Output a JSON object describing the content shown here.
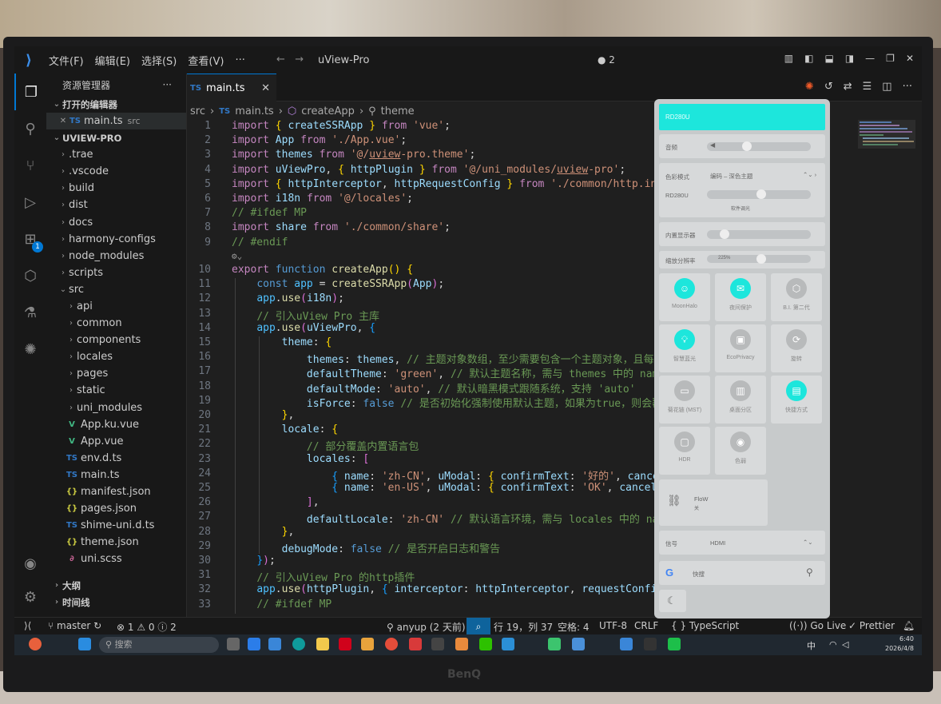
{
  "titlebar": {
    "menus": [
      "文件(F)",
      "编辑(E)",
      "选择(S)",
      "查看(V)",
      "···"
    ],
    "title": "uView-Pro",
    "badge": "● 2"
  },
  "sidebar": {
    "header": "资源管理器",
    "open_editors": "打开的编辑器",
    "open_file": "main.ts",
    "open_file_dir": "src",
    "project": "UVIEW-PRO",
    "items": [
      {
        "label": ".trae",
        "type": "folder",
        "depth": 1
      },
      {
        "label": ".vscode",
        "type": "folder",
        "depth": 1
      },
      {
        "label": "build",
        "type": "folder",
        "depth": 1
      },
      {
        "label": "dist",
        "type": "folder",
        "depth": 1
      },
      {
        "label": "docs",
        "type": "folder",
        "depth": 1
      },
      {
        "label": "harmony-configs",
        "type": "folder",
        "depth": 1
      },
      {
        "label": "node_modules",
        "type": "folder",
        "depth": 1
      },
      {
        "label": "scripts",
        "type": "folder",
        "depth": 1
      },
      {
        "label": "src",
        "type": "folder-open",
        "depth": 1
      },
      {
        "label": "api",
        "type": "folder",
        "depth": 2
      },
      {
        "label": "common",
        "type": "folder",
        "depth": 2
      },
      {
        "label": "components",
        "type": "folder",
        "depth": 2
      },
      {
        "label": "locales",
        "type": "folder",
        "depth": 2
      },
      {
        "label": "pages",
        "type": "folder",
        "depth": 2
      },
      {
        "label": "static",
        "type": "folder",
        "depth": 2
      },
      {
        "label": "uni_modules",
        "type": "folder",
        "depth": 2
      },
      {
        "label": "App.ku.vue",
        "type": "vue",
        "depth": 2
      },
      {
        "label": "App.vue",
        "type": "vue",
        "depth": 2
      },
      {
        "label": "env.d.ts",
        "type": "ts",
        "depth": 2
      },
      {
        "label": "main.ts",
        "type": "ts",
        "depth": 2
      },
      {
        "label": "manifest.json",
        "type": "json",
        "depth": 2
      },
      {
        "label": "pages.json",
        "type": "json",
        "depth": 2
      },
      {
        "label": "shime-uni.d.ts",
        "type": "ts",
        "depth": 2
      },
      {
        "label": "theme.json",
        "type": "json",
        "depth": 2
      },
      {
        "label": "uni.scss",
        "type": "scss",
        "depth": 2
      }
    ],
    "outline": "大纲",
    "timeline": "时间线"
  },
  "tab": {
    "label": "main.ts",
    "close": "✕"
  },
  "breadcrumb": [
    "src",
    "main.ts",
    "createApp",
    "theme"
  ],
  "editor": {
    "line_numbers": [
      "1",
      "2",
      "3",
      "4",
      "5",
      "6",
      "7",
      "8",
      "9",
      "",
      "10",
      "11",
      "12",
      "13",
      "14",
      "15",
      "16",
      "17",
      "18",
      "19",
      "20",
      "21",
      "22",
      "23",
      "24",
      "25",
      "26",
      "27",
      "28",
      "29",
      "30",
      "31",
      "32",
      "33"
    ]
  },
  "statusbar": {
    "branch": "master",
    "problems": "⊗ 1 ⚠ 0 ⓘ 2",
    "blame": "anyup (2 天前)",
    "position": "行 19，列 37",
    "spaces": "空格: 4",
    "encoding": "UTF-8",
    "eol": "CRLF",
    "language": "{ } TypeScript",
    "golive": "Go Live",
    "prettier": "✓ Prettier"
  },
  "taskbar": {
    "search_placeholder": "搜索",
    "time": "6:40",
    "date": "2026/4/8",
    "ime": "中"
  },
  "panel": {
    "top_label": "RD280U",
    "volume_label": "音频",
    "color_mode_label": "色彩模式",
    "color_mode_value": "编码 – 深色主题",
    "monitor_label": "RD280U",
    "software_adjust": "软件调光",
    "builtin_display": "内置显示器",
    "scale_label": "缩放分辨率",
    "scale_value": "225%",
    "tiles": [
      {
        "label": "MoonHalo",
        "on": true
      },
      {
        "label": "夜间保护",
        "on": true
      },
      {
        "label": "B.I. 第二代",
        "on": false
      },
      {
        "label": "智慧蓝光",
        "on": true
      },
      {
        "label": "EcoPrivacy",
        "on": false
      },
      {
        "label": "旋转",
        "on": false
      },
      {
        "label": "菊花链 (MST)",
        "on": false
      },
      {
        "label": "桌面分区",
        "on": false
      },
      {
        "label": "快捷方式",
        "on": true
      },
      {
        "label": "HDR",
        "on": false
      },
      {
        "label": "色弱",
        "on": false
      }
    ],
    "flow_label": "FloW",
    "flow_sub": "关",
    "signal_label": "信号",
    "signal_value": "HDMI",
    "search_placeholder": "快搜"
  },
  "monitor_brand": "BenQ",
  "colors": {
    "accent": "#0078d4",
    "cyan": "#1de6dc",
    "editor_bg": "#1f1f1f"
  }
}
